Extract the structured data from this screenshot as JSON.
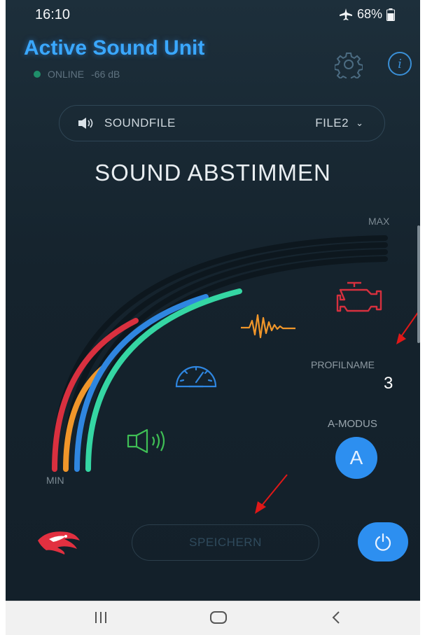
{
  "status_bar": {
    "time": "16:10",
    "battery": "68%"
  },
  "header": {
    "title": "Active Sound Unit",
    "status": "ONLINE",
    "signal": "-66 dB"
  },
  "sound_selector": {
    "label": "SOUNDFILE",
    "value": "FILE2"
  },
  "main": {
    "heading": "SOUND ABSTIMMEN",
    "max_label": "MAX",
    "min_label": "MIN",
    "profile_label": "PROFILNAME",
    "profile_value": "3",
    "mode_label": "A-MODUS",
    "mode_button": "A"
  },
  "footer": {
    "save_label": "SPEICHERN"
  },
  "colors": {
    "accent": "#2d8ff0",
    "red": "#d9303f",
    "orange": "#f0962a",
    "blue": "#2f86e0",
    "green": "#35d6a3"
  }
}
